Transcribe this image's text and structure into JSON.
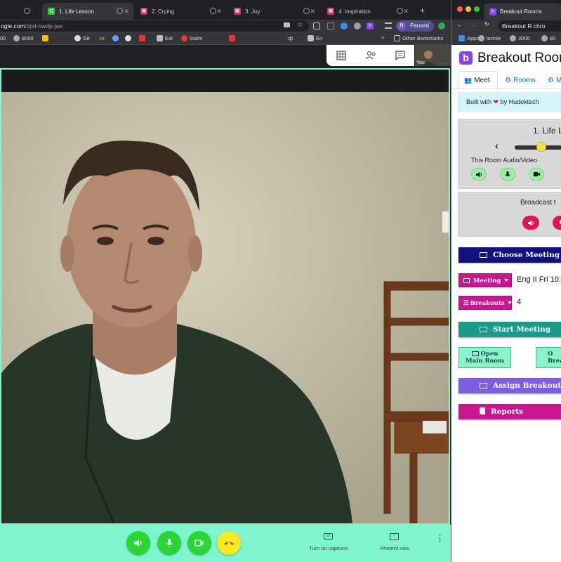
{
  "browser_left": {
    "tabs": [
      {
        "label": "1. Life Lesson",
        "favicon_color": "#2ecc40",
        "favicon_letter": "C",
        "active": true
      },
      {
        "label": "2. Crying",
        "favicon_color": "#d6247a",
        "favicon_letter": "⌘",
        "active": false
      },
      {
        "label": "3. Joy",
        "favicon_color": "#d6247a",
        "favicon_letter": "⌘",
        "active": false
      },
      {
        "label": "4. Inspiration",
        "favicon_color": "#d6247a",
        "favicon_letter": "⌘",
        "active": false
      }
    ],
    "new_tab": "+",
    "url_host": "ogle.com",
    "url_path": "/zpd-owdp-jwx",
    "profile_initial": "N",
    "profile_status": "Paused",
    "bookmarks": [
      {
        "label": "00",
        "color": "#888"
      },
      {
        "label": "8000",
        "color": "#aaa"
      },
      {
        "label": "",
        "color": "#e8c21c"
      },
      {
        "label": "Git",
        "color": "#ddd"
      },
      {
        "label": "in",
        "color": "#e98b2a"
      },
      {
        "label": "",
        "color": "#58a6ff"
      },
      {
        "label": "",
        "color": "#ddd"
      },
      {
        "label": "",
        "color": "#e53935"
      },
      {
        "label": "Ext",
        "color": "#bbb"
      },
      {
        "label": "Swim",
        "color": "#e53935"
      },
      {
        "label": "",
        "color": "#e53935"
      },
      {
        "label": "中",
        "color": "#999"
      },
      {
        "label": "En",
        "color": "#bbb"
      },
      {
        "label": "Other Bookmarks",
        "color": "#bdc1c6"
      }
    ]
  },
  "meet": {
    "self_label": "You",
    "captions_label": "Turn on captions",
    "present_label": "Present now",
    "top_icons": [
      "grid-icon",
      "people-icon",
      "chat-icon"
    ],
    "accent_color": "#7ff5cf"
  },
  "browser_right": {
    "tab_label": "Breakout Rooms",
    "url_text": "Breakout R  chro",
    "bookmarks": [
      "Apps",
      "lonnie",
      "3000",
      "80"
    ]
  },
  "app": {
    "title": "Breakout Room",
    "tabs": [
      "Meet",
      "Rooms",
      "M"
    ],
    "built_with_prefix": "Built with",
    "heart": "❤",
    "built_with_suffix": "by Hudektech",
    "room_name": "1. Life L",
    "av_label": "This Room Audio/Video",
    "broadcast_label": "Broadcast t",
    "choose_meeting": "Choose Meeting an",
    "meeting_button": "Meeting",
    "meeting_value": "Eng II Fri 10:",
    "breakouts_button": "Breakouts",
    "breakouts_value": "4",
    "start_meeting": "Start Meeting",
    "open_main_room_1": "Open",
    "open_main_room_2": "Main Room",
    "open_breakouts_1": "O",
    "open_breakouts_2": "Brea",
    "assign_breakouts": "Assign Breakouts",
    "reports": "Reports",
    "colors": {
      "navy": "#12127e",
      "teal": "#1e9a8a",
      "purple": "#7b5fe0",
      "magenta": "#c8178f",
      "mint": "#8af4c6",
      "brand": "#8a3ffc"
    }
  }
}
